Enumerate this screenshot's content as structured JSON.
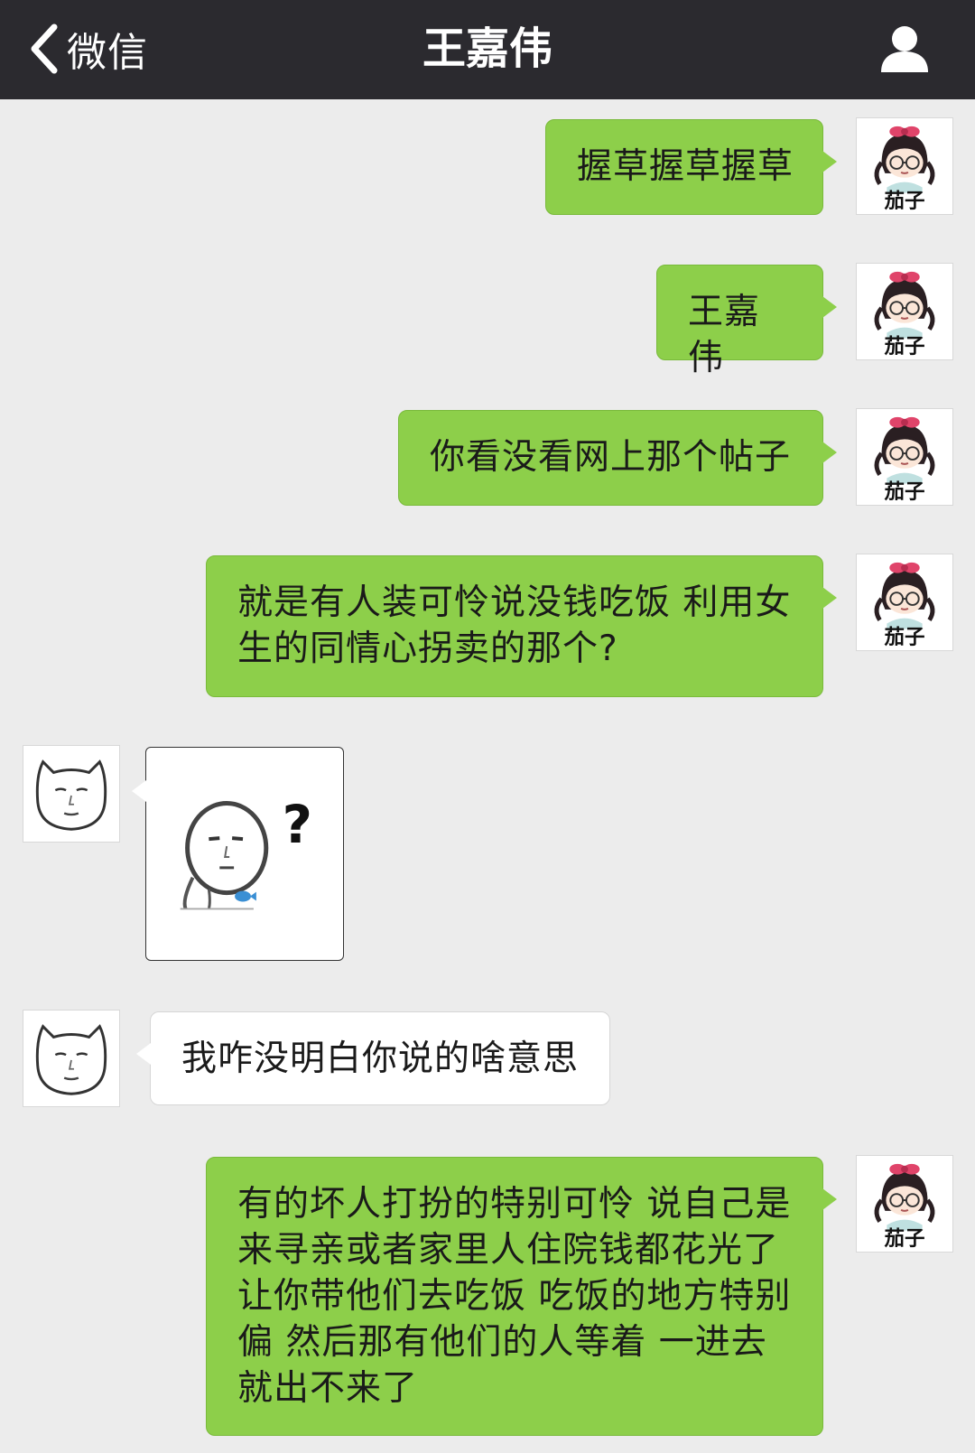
{
  "header": {
    "back_label": "微信",
    "title": "王嘉伟"
  },
  "avatars": {
    "self_label": "茄子"
  },
  "messages": [
    {
      "side": "out",
      "text": "握草握草握草"
    },
    {
      "side": "out",
      "text": "王嘉伟"
    },
    {
      "side": "out",
      "text": "你看没看网上那个帖子"
    },
    {
      "side": "out",
      "text": "就是有人装可怜说没钱吃饭 利用女生的同情心拐卖的那个?"
    },
    {
      "side": "in",
      "type": "sticker",
      "sticker_text": "?"
    },
    {
      "side": "in",
      "text": "我咋没明白你说的啥意思"
    },
    {
      "side": "out",
      "text": "有的坏人打扮的特别可怜 说自己是来寻亲或者家里人住院钱都花光了 让你带他们去吃饭 吃饭的地方特别偏 然后那有他们的人等着 一进去就出不来了"
    }
  ],
  "colors": {
    "header_bg": "#2b2a2f",
    "chat_bg": "#ececec",
    "outgoing_bubble": "#8dcf4a",
    "incoming_bubble": "#ffffff"
  },
  "icons": {
    "back": "chevron-left-icon",
    "profile": "person-icon"
  }
}
